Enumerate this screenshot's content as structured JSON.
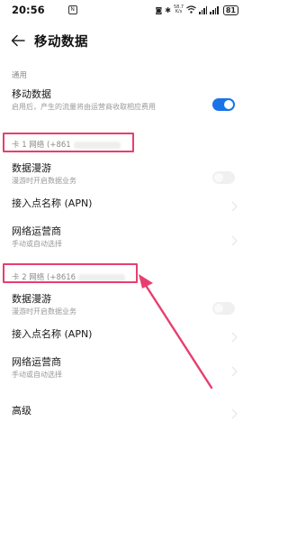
{
  "status_bar": {
    "time": "20:56",
    "nfc": "N",
    "speed_top": "58.7",
    "speed_bottom": "K/s",
    "battery": "81"
  },
  "header": {
    "title": "移动数据"
  },
  "general": {
    "section_label": "通用",
    "mobile_data_title": "移动数据",
    "mobile_data_sub": "启用后，产生的流量将由运营商收取相应费用",
    "mobile_data_on": true
  },
  "sim1": {
    "section_label": "卡 1 网络 (+861",
    "roaming_title": "数据漫游",
    "roaming_sub": "漫游时开启数据业务",
    "apn_title": "接入点名称 (APN)",
    "operator_title": "网络运营商",
    "operator_sub": "手动或自动选择"
  },
  "sim2": {
    "section_label": "卡 2 网络 (+8616",
    "roaming_title": "数据漫游",
    "roaming_sub": "漫游时开启数据业务",
    "apn_title": "接入点名称 (APN)",
    "operator_title": "网络运营商",
    "operator_sub": "手动或自动选择"
  },
  "advanced": {
    "title": "高级"
  },
  "colors": {
    "accent": "#1a73e8",
    "annotation": "#e83e6f"
  }
}
